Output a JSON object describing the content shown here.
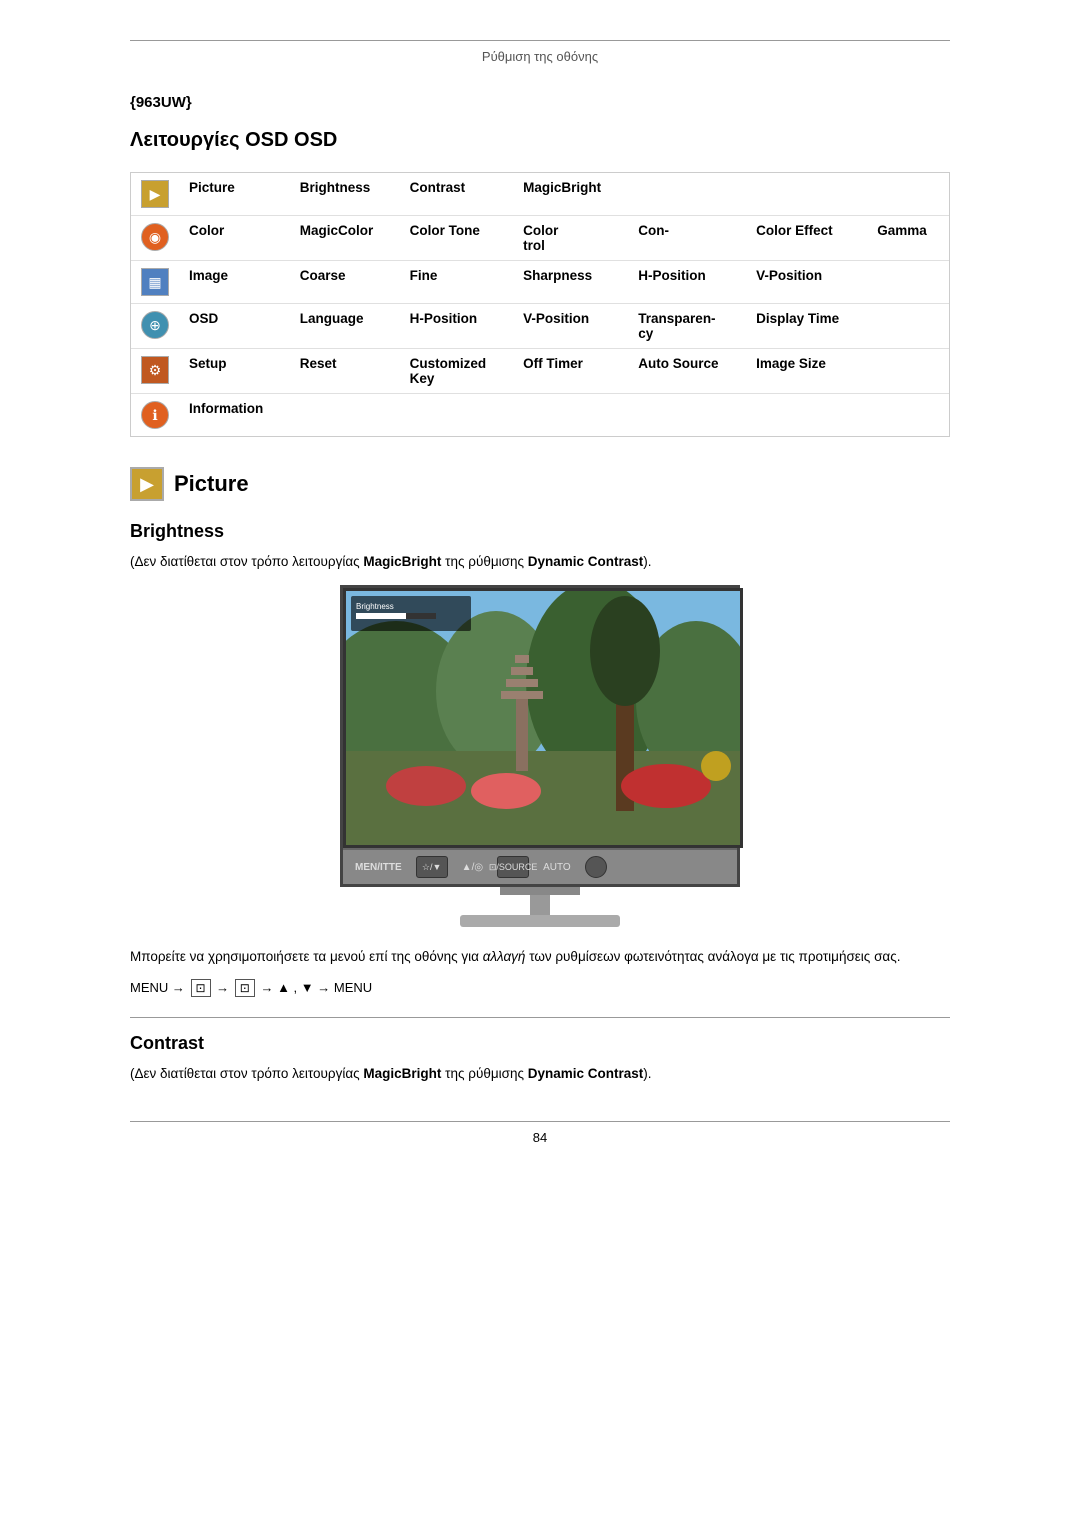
{
  "header": {
    "title": "Ρύθμιση της οθόνης"
  },
  "model": {
    "name": "{963UW}"
  },
  "osd_section": {
    "title": "Λειτουργίες OSD"
  },
  "osd_table": {
    "rows": [
      {
        "icon": "picture",
        "label": "Picture",
        "items": [
          "Brightness",
          "Contrast",
          "MagicBright"
        ]
      },
      {
        "icon": "color",
        "label": "Color",
        "items": [
          "MagicColor",
          "Color Tone",
          "Color trol",
          "Con-",
          "Color Effect",
          "Gamma"
        ]
      },
      {
        "icon": "image",
        "label": "Image",
        "items": [
          "Coarse",
          "Fine",
          "Sharpness",
          "H-Position",
          "V-Position"
        ]
      },
      {
        "icon": "osd",
        "label": "OSD",
        "items": [
          "Language",
          "H-Position",
          "V-Position",
          "Transparen- cy",
          "Display Time"
        ]
      },
      {
        "icon": "setup",
        "label": "Setup",
        "items": [
          "Reset",
          "Customized Key",
          "Off Timer",
          "Auto Source",
          "Image Size"
        ]
      },
      {
        "icon": "info",
        "label": "Information",
        "items": []
      }
    ]
  },
  "picture_section": {
    "heading": "Picture",
    "brightness": {
      "title": "Brightness",
      "note": "(Δεν διατίθεται στον τρόπο λειτουργίας MagicBright της ρύθμισης Dynamic Contrast).",
      "body_text": "Μπορείτε να χρησιμοποιήσετε τα μενού επί της οθόνης για αλλαγή των ρυθμίσεων φωτεινότητας ανάλογα με τις προτιμήσεις σας.",
      "navigation": "MENU → ⊡ → ⊡ → ▲ , ▼ → MENU"
    },
    "contrast": {
      "title": "Contrast",
      "note": "(Δεν διατίθεται στον τρόπο λειτουργίας MagicBright της ρύθμισης Dynamic Contrast)."
    }
  },
  "monitor_controls": {
    "buttons": [
      "MEN/ITTE",
      "☆/▼",
      "▲/◎",
      "⊡/SOURCE",
      "AUTO"
    ]
  },
  "footer": {
    "page_number": "84"
  }
}
